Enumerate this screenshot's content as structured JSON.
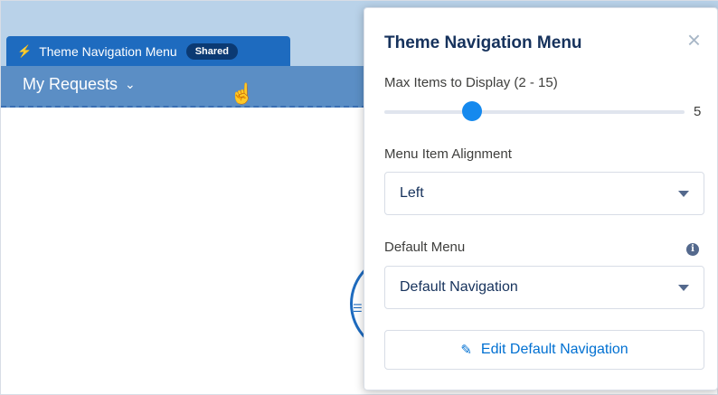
{
  "component": {
    "tab_title": "Theme Navigation Menu",
    "badge": "Shared",
    "nav_label": "My Requests"
  },
  "panel": {
    "title": "Theme Navigation Menu",
    "max_items": {
      "label": "Max Items to Display (2 - 15)",
      "min": 2,
      "max": 15,
      "value": "5"
    },
    "alignment": {
      "label": "Menu Item Alignment",
      "value": "Left"
    },
    "default_menu": {
      "label": "Default Menu",
      "value": "Default Navigation"
    },
    "edit_button_label": "Edit Default Navigation"
  },
  "colors": {
    "accent": "#1589ee",
    "nav_bar": "#5b8ec5",
    "tab": "#1e6bbf",
    "link": "#0070d2"
  },
  "icons": [
    "bolt-icon",
    "chevron-down-icon",
    "hand-cursor-icon",
    "close-icon",
    "info-icon",
    "pencil-icon",
    "caret-down-icon"
  ]
}
